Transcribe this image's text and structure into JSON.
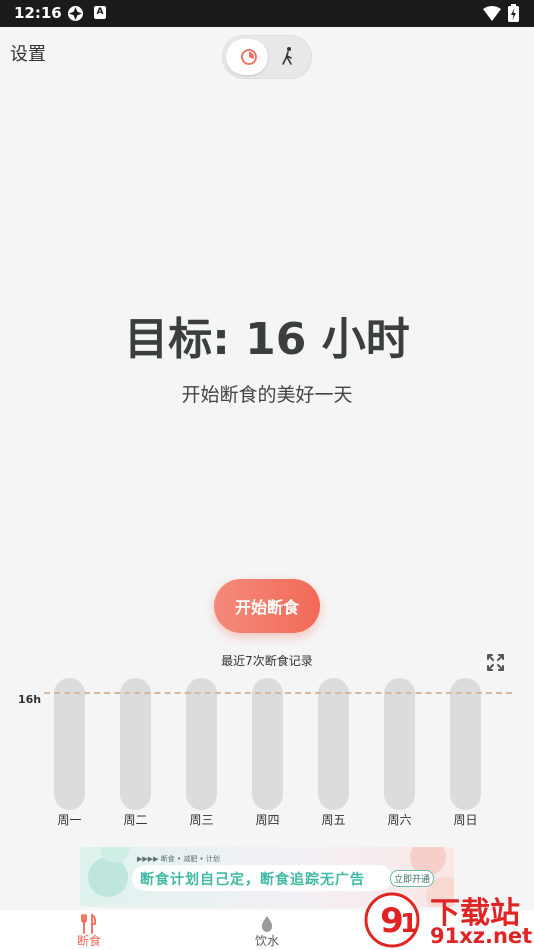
{
  "status_bar": {
    "time": "12:16",
    "app_badge": "A"
  },
  "header": {
    "settings_label": "设置"
  },
  "goal": {
    "title": "目标: 16 小时",
    "subtitle": "开始断食的美好一天"
  },
  "start_button_label": "开始断食",
  "records": {
    "title": "最近7次断食记录",
    "target_label": "16h",
    "target_hours": 16,
    "days": [
      "周一",
      "周二",
      "周三",
      "周四",
      "周五",
      "周六",
      "周日"
    ],
    "fasting_hours": [
      0,
      0,
      0,
      0,
      0,
      0,
      0
    ]
  },
  "ad": {
    "small_text": "▶▶▶▶  断食 • 减肥 • 计划",
    "headline": "断食计划自己定，断食追踪无广告",
    "button": "立即开通"
  },
  "bottom_nav": {
    "items": [
      {
        "label": "断食",
        "icon": "fork-knife-icon",
        "active": true
      },
      {
        "label": "饮水",
        "icon": "water-drop-icon",
        "active": false
      }
    ]
  },
  "watermark": {
    "line1": "下载站",
    "line2": "91xz.net"
  },
  "colors": {
    "accent": "#f26a57",
    "bar": "#dcdcdc",
    "dash": "#d4b8a0",
    "ad_text": "#3fb9a3",
    "watermark": "#e02424"
  }
}
